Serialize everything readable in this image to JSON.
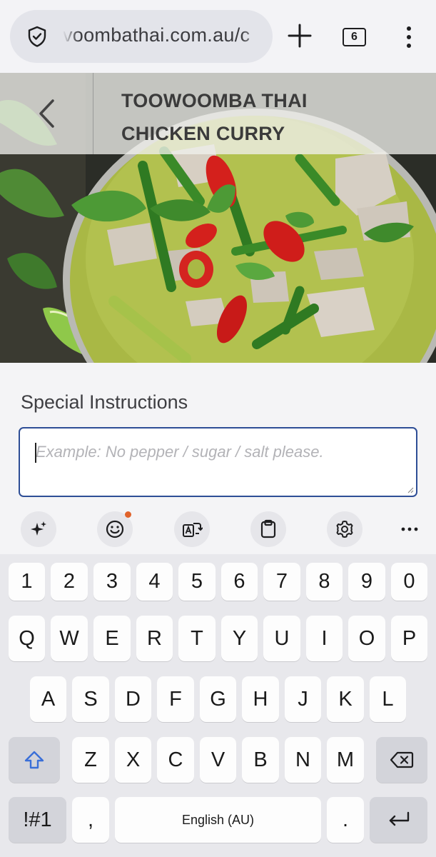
{
  "browser": {
    "url": "voombathai.com.au/c",
    "tab_count": "6",
    "icons": {
      "security": "shield-check-icon",
      "new_tab": "plus-icon",
      "tabs": "tab-counter-icon",
      "menu": "more-vertical-icon"
    }
  },
  "hero": {
    "title_line1": "TOOWOOMBA THAI",
    "title_line2": "CHICKEN CURRY",
    "back_icon": "chevron-left-icon",
    "image": "green-curry-dish-photo"
  },
  "form": {
    "label": "Special Instructions",
    "instructions_value": "",
    "instructions_placeholder": "Example: No pepper / sugar / salt please."
  },
  "keyboard_toolbar": {
    "items": [
      {
        "name": "ai-sparkle-icon"
      },
      {
        "name": "emoji-icon",
        "badge": true
      },
      {
        "name": "translate-icon"
      },
      {
        "name": "clipboard-icon"
      },
      {
        "name": "settings-gear-icon"
      },
      {
        "name": "more-horizontal-icon"
      }
    ]
  },
  "keyboard": {
    "number_row": [
      "1",
      "2",
      "3",
      "4",
      "5",
      "6",
      "7",
      "8",
      "9",
      "0"
    ],
    "row1": [
      "Q",
      "W",
      "E",
      "R",
      "T",
      "Y",
      "U",
      "I",
      "O",
      "P"
    ],
    "row2": [
      "A",
      "S",
      "D",
      "F",
      "G",
      "H",
      "J",
      "K",
      "L"
    ],
    "row3": [
      "Z",
      "X",
      "C",
      "V",
      "B",
      "N",
      "M"
    ],
    "symbols_label": "!#1",
    "comma_label": ",",
    "space_label": "English (AU)",
    "period_label": ".",
    "shift_icon": "shift-arrow-icon",
    "backspace_icon": "backspace-icon",
    "enter_icon": "enter-return-icon"
  },
  "colors": {
    "focus_border": "#2e4e96",
    "badge": "#e0632b",
    "shift_accent": "#3a6fd8"
  }
}
